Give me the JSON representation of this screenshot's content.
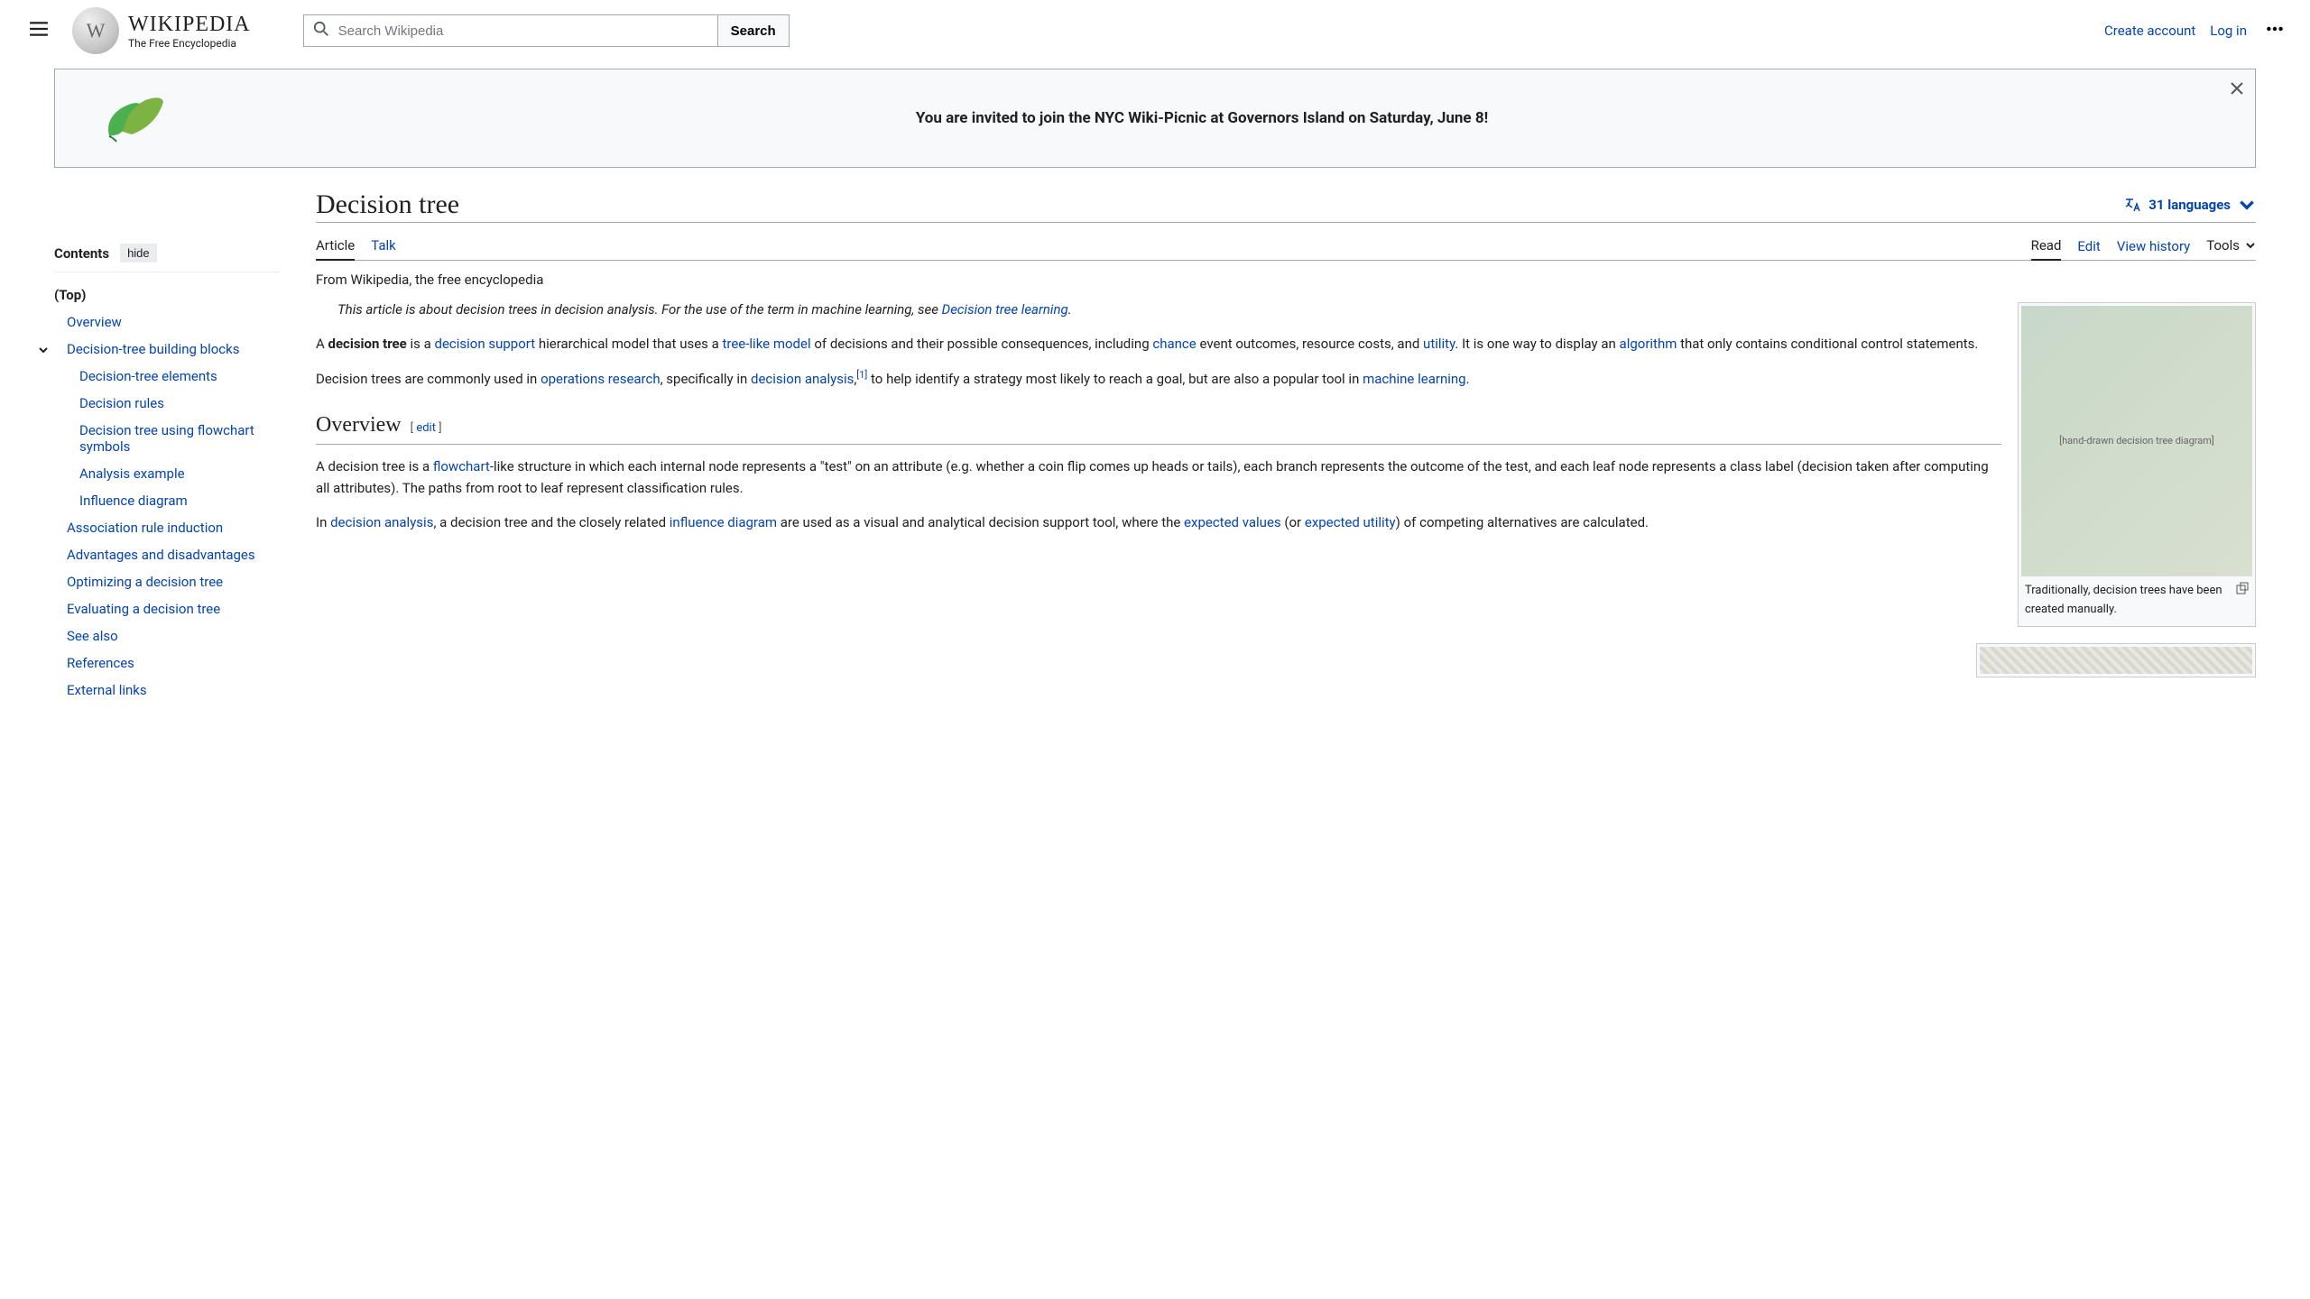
{
  "header": {
    "wordmark": "WIKIPEDIA",
    "tagline": "The Free Encyclopedia",
    "search_placeholder": "Search Wikipedia",
    "search_button": "Search",
    "create_account": "Create account",
    "log_in": "Log in"
  },
  "banner": {
    "text": "You are invited to join the NYC Wiki-Picnic at Governors Island on Saturday, June 8!"
  },
  "sidebar": {
    "contents_label": "Contents",
    "hide_label": "hide",
    "items": [
      {
        "label": "(Top)",
        "class": "top"
      },
      {
        "label": "Overview",
        "class": ""
      },
      {
        "label": "Decision-tree building blocks",
        "class": "has-chevron"
      },
      {
        "label": "Decision-tree elements",
        "class": "subsub"
      },
      {
        "label": "Decision rules",
        "class": "subsub"
      },
      {
        "label": "Decision tree using flowchart symbols",
        "class": "subsub"
      },
      {
        "label": "Analysis example",
        "class": "subsub"
      },
      {
        "label": "Influence diagram",
        "class": "subsub"
      },
      {
        "label": "Association rule induction",
        "class": ""
      },
      {
        "label": "Advantages and disadvantages",
        "class": ""
      },
      {
        "label": "Optimizing a decision tree",
        "class": ""
      },
      {
        "label": "Evaluating a decision tree",
        "class": ""
      },
      {
        "label": "See also",
        "class": ""
      },
      {
        "label": "References",
        "class": ""
      },
      {
        "label": "External links",
        "class": ""
      }
    ]
  },
  "article": {
    "title": "Decision tree",
    "languages": "31 languages",
    "tabs": {
      "article": "Article",
      "talk": "Talk",
      "read": "Read",
      "edit": "Edit",
      "view_history": "View history",
      "tools": "Tools"
    },
    "subtitle": "From Wikipedia, the free encyclopedia",
    "hatnote_prefix": "This article is about decision trees in decision analysis. For the use of the term in machine learning, see ",
    "hatnote_link": "Decision tree learning",
    "hatnote_suffix": ".",
    "p1": {
      "t1": "A ",
      "b1": "decision tree",
      "t2": " is a ",
      "l1": "decision support",
      "t3": " hierarchical model that uses a ",
      "l2": "tree-like model",
      "t4": " of decisions and their possible consequences, including ",
      "l3": "chance",
      "t5": " event outcomes, resource costs, and ",
      "l4": "utility",
      "t6": ". It is one way to display an ",
      "l5": "algorithm",
      "t7": " that only contains conditional control statements."
    },
    "p2": {
      "t1": "Decision trees are commonly used in ",
      "l1": "operations research",
      "t2": ", specifically in ",
      "l2": "decision analysis",
      "t3": ",",
      "sup": "[1]",
      "t4": " to help identify a strategy most likely to reach a goal, but are also a popular tool in ",
      "l3": "machine learning",
      "t5": "."
    },
    "section_overview": "Overview",
    "edit_bracket_open": "[ ",
    "edit_label": "edit",
    "edit_bracket_close": " ]",
    "p3": {
      "t1": "A decision tree is a ",
      "l1": "flowchart",
      "t2": "-like structure in which each internal node represents a \"test\" on an attribute (e.g. whether a coin flip comes up heads or tails), each branch represents the outcome of the test, and each leaf node represents a class label (decision taken after computing all attributes). The paths from root to leaf represent classification rules."
    },
    "p4": {
      "t1": "In ",
      "l1": "decision analysis",
      "t2": ", a decision tree and the closely related ",
      "l2": "influence diagram",
      "t3": " are used as a visual and analytical decision support tool, where the ",
      "l3": "expected values",
      "t4": " (or ",
      "l4": "expected utility",
      "t5": ") of competing alternatives are calculated."
    },
    "figure_caption": "Traditionally, decision trees have been created manually.",
    "figure_placeholder": "[hand-drawn decision tree diagram]"
  }
}
